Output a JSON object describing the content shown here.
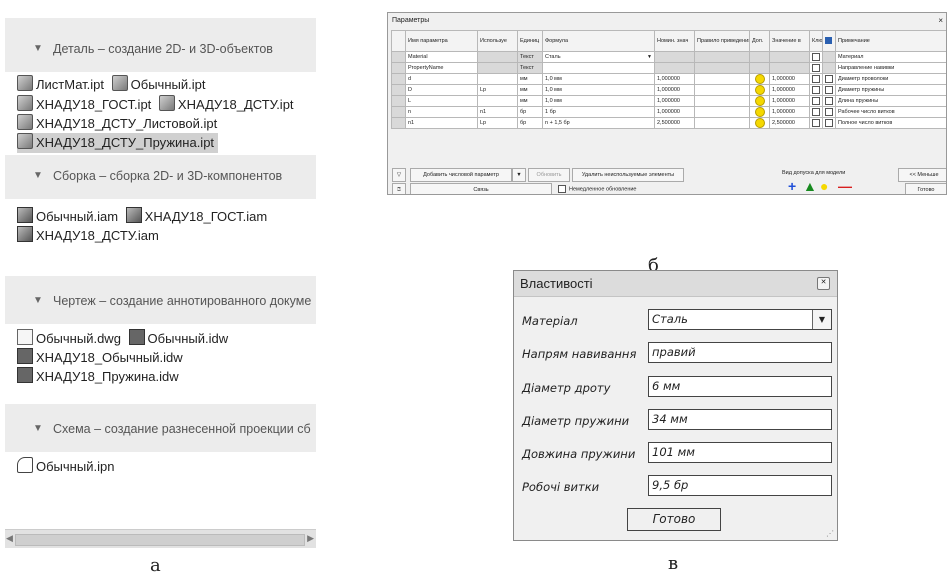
{
  "panel_a": {
    "sections": [
      {
        "header": "Деталь – создание 2D- и 3D-объектов",
        "lines": [
          [
            "ЛистМат.ipt",
            "Обычный.ipt"
          ],
          [
            "ХНАДУ18_ГОСТ.ipt",
            "ХНАДУ18_ДСТУ.ipt"
          ],
          [
            "ХНАДУ18_ДСТУ_Листовой.ipt"
          ],
          [
            "ХНАДУ18_ДСТУ_Пружина.ipt"
          ]
        ]
      },
      {
        "header": "Сборка – сборка 2D- и 3D-компонентов",
        "lines": [
          [
            "Обычный.iam",
            "ХНАДУ18_ГОСТ.iam"
          ],
          [
            "ХНАДУ18_ДСТУ.iam"
          ]
        ]
      },
      {
        "header": "Чертеж – создание аннотированного докумен",
        "lines": [
          [
            "Обычный.dwg",
            "Обычный.idw"
          ],
          [
            "ХНАДУ18_Обычный.idw"
          ],
          [
            "ХНАДУ18_Пружина.idw"
          ]
        ]
      },
      {
        "header": "Схема – создание разнесенной проекции сбор",
        "lines": [
          [
            "Обычный.ipn"
          ]
        ]
      }
    ],
    "caption": "а"
  },
  "panel_b": {
    "title": "Параметры",
    "headers": [
      "Имя параметра",
      "Используе",
      "Единиц",
      "Формула",
      "Номин. знач",
      "Правило приведения к диа",
      "Доп.",
      "Значение в",
      "Клю",
      "",
      "Примечание"
    ],
    "rows": [
      {
        "name": "Material",
        "used": "",
        "unit": "Текст",
        "formula": "Сталь",
        "nominal": "",
        "rule": "",
        "tol": "",
        "model": "",
        "note": "Материал"
      },
      {
        "name": "PropertyName",
        "used": "",
        "unit": "Текст",
        "formula": "",
        "nominal": "",
        "rule": "",
        "tol": "",
        "model": "",
        "note": "Направление навивки"
      },
      {
        "name": "d",
        "used": "",
        "unit": "мм",
        "formula": "1,0 мм",
        "nominal": "1,000000",
        "rule": "",
        "tol": "dot",
        "model": "1,000000",
        "note": "Диаметр проволоки"
      },
      {
        "name": "D",
        "used": "Lp",
        "unit": "мм",
        "formula": "1,0 мм",
        "nominal": "1,000000",
        "rule": "",
        "tol": "dot",
        "model": "1,000000",
        "note": "Диаметр пружины"
      },
      {
        "name": "L",
        "used": "",
        "unit": "мм",
        "formula": "1,0 мм",
        "nominal": "1,000000",
        "rule": "",
        "tol": "dot",
        "model": "1,000000",
        "note": "Длина пружины"
      },
      {
        "name": "n",
        "used": "n1",
        "unit": "бр",
        "formula": "1 бр",
        "nominal": "1,000000",
        "rule": "",
        "tol": "dot",
        "model": "1,000000",
        "note": "Рабочее число витков"
      },
      {
        "name": "n1",
        "used": "Lp",
        "unit": "бр",
        "formula": "n + 1,5 бр",
        "nominal": "2,500000",
        "rule": "",
        "tol": "dot",
        "model": "2,500000",
        "note": "Полное число витков"
      }
    ],
    "buttons": {
      "add": "Добавить числовой параметр",
      "refresh": "Обновить",
      "delete_unused": "Удалить неиспользуемые элементы",
      "link": "Связь",
      "immediate_update": "Немедленное обновление",
      "tolerance_label": "Вид допуска для модели",
      "less": "<< Меньше",
      "done": "Готово"
    },
    "caption": "б"
  },
  "panel_c": {
    "title": "Властивості",
    "fields": [
      {
        "label": "Матеріал",
        "value": "Сталь",
        "dropdown": true
      },
      {
        "label": "Напрям навивання",
        "value": "правий"
      },
      {
        "label": "Діаметр дроту",
        "value": "6 мм"
      },
      {
        "label": "Діаметр пружини",
        "value": "34 мм"
      },
      {
        "label": "Довжина пружини",
        "value": "101 мм"
      },
      {
        "label": "Робочі витки",
        "value": "9,5 бр"
      }
    ],
    "done_label": "Готово",
    "caption": "в"
  },
  "colors": {
    "tol_plus": "#1f4fd8",
    "tol_triangle": "#178a1f",
    "tol_circle": "#f5d800",
    "tol_minus": "#d81f1f"
  }
}
